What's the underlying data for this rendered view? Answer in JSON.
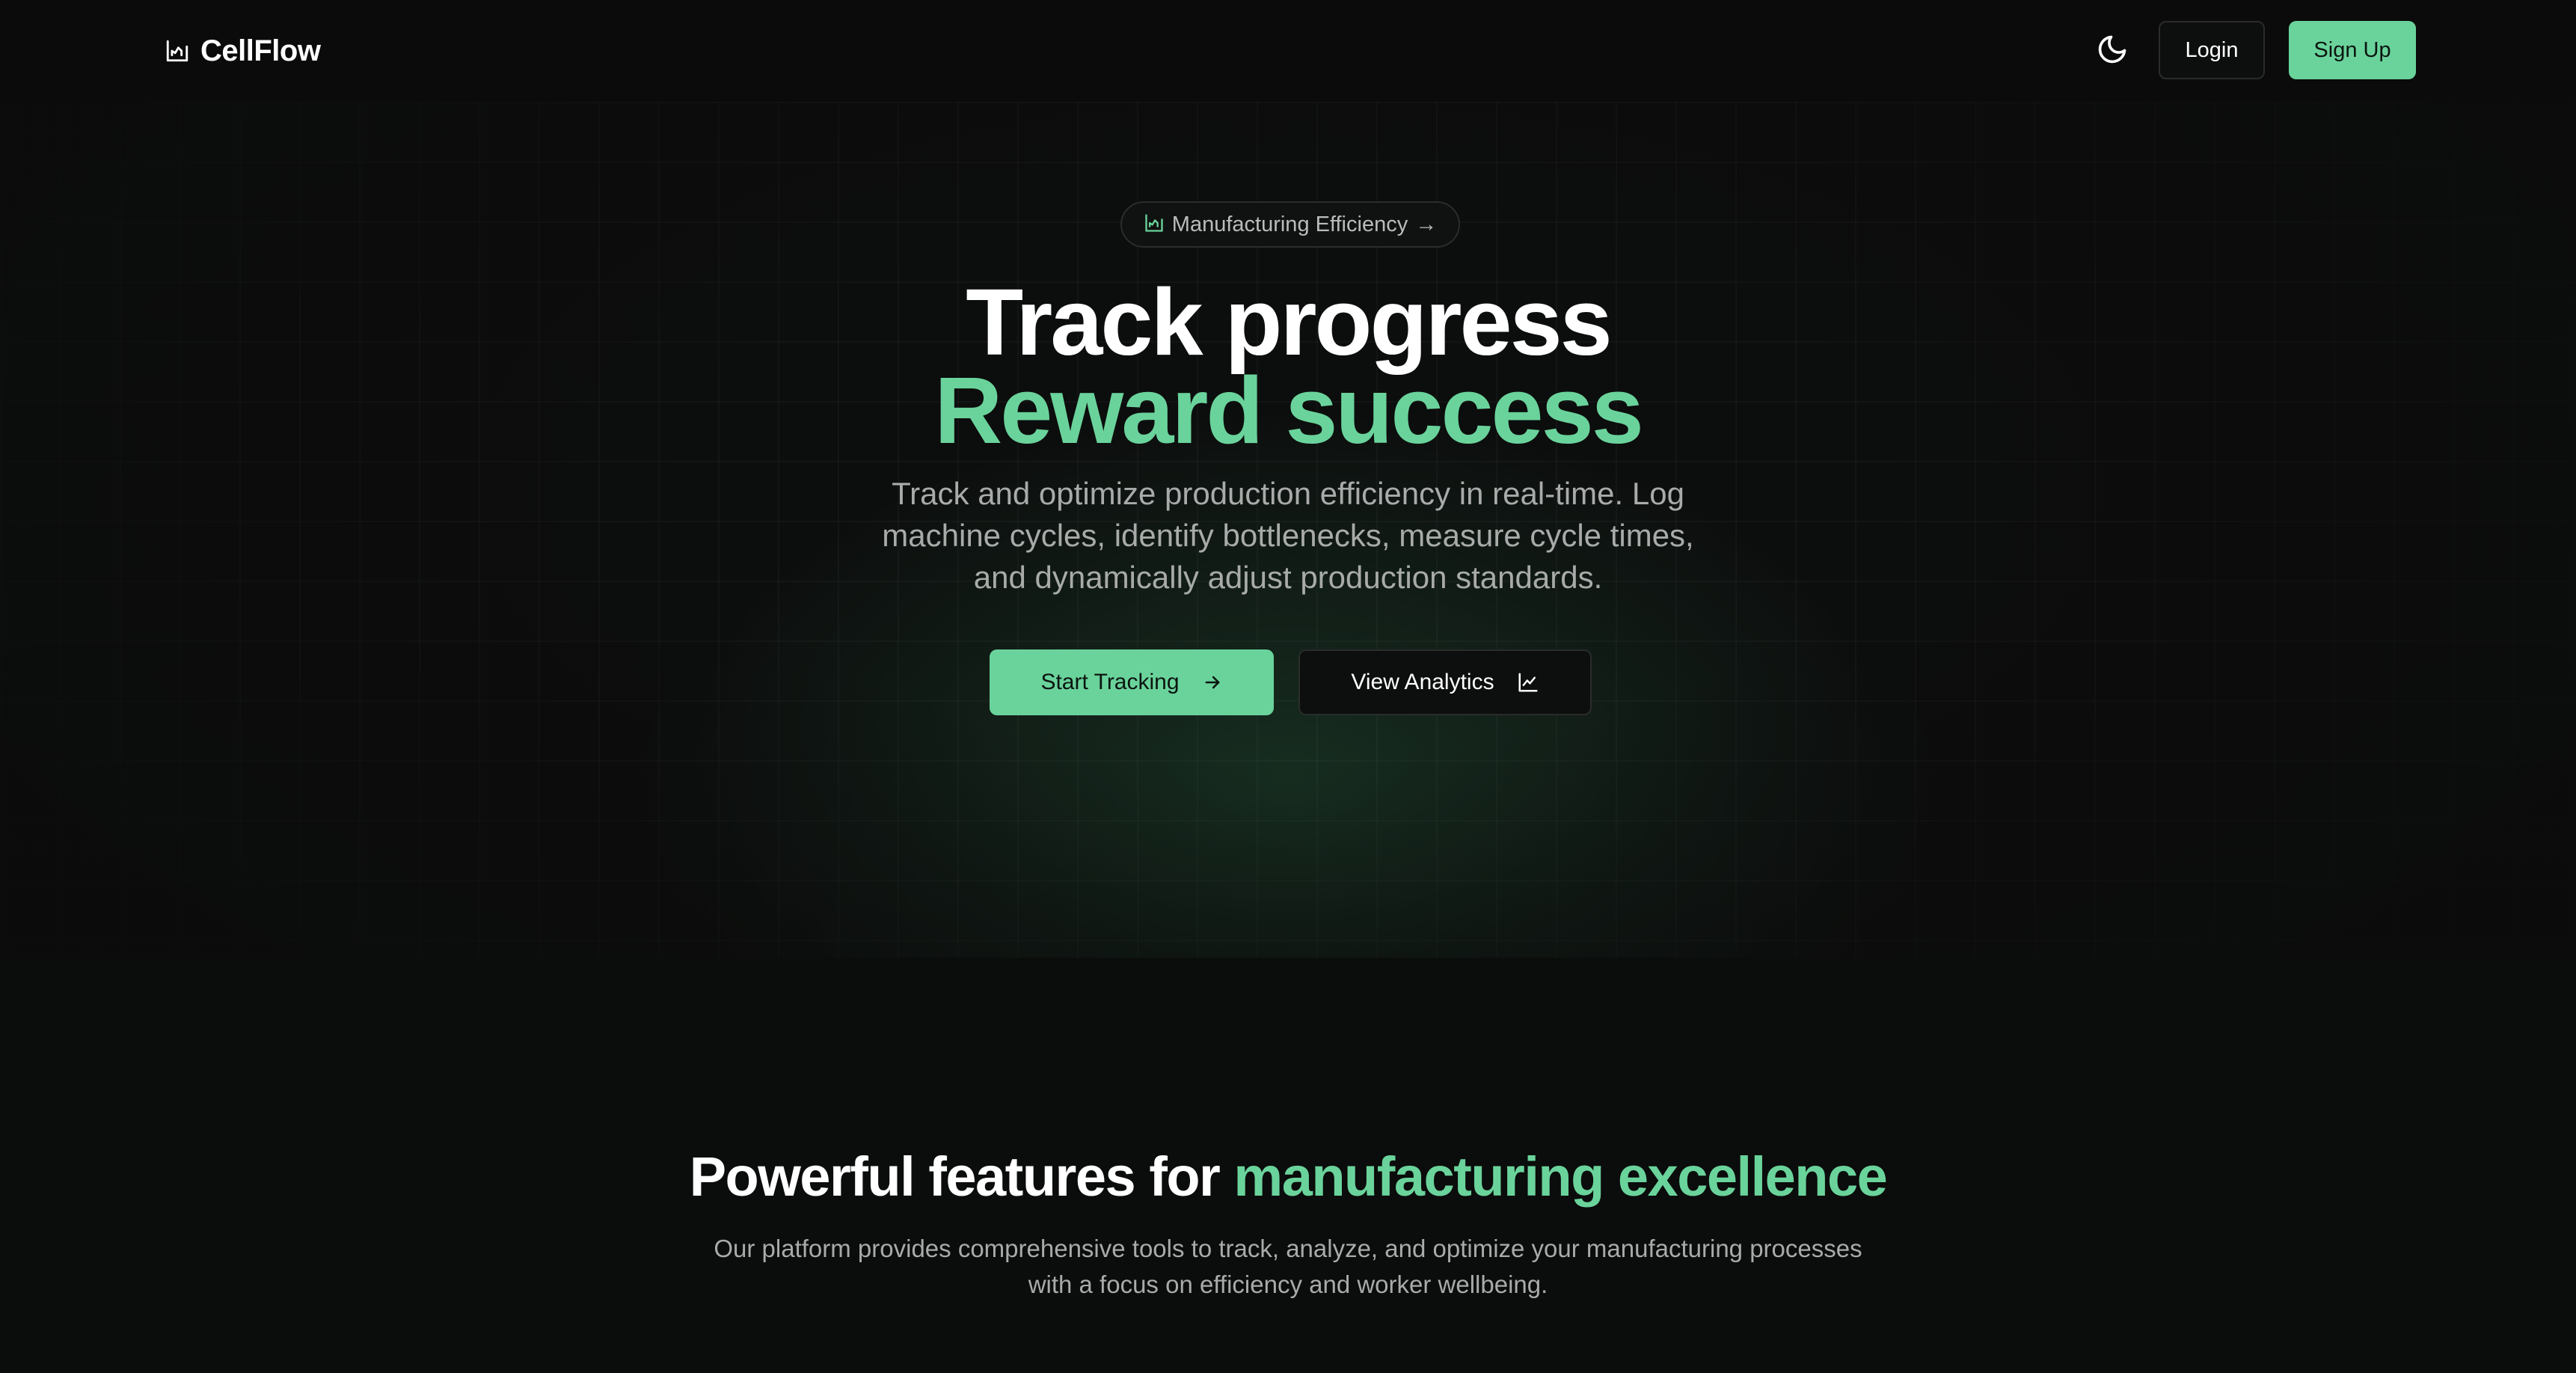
{
  "header": {
    "brand_icon": "chart-icon",
    "brand_name": "CellFlow",
    "theme_toggle_icon": "moon-icon",
    "login_label": "Login",
    "signup_label": "Sign Up"
  },
  "hero": {
    "badge": {
      "icon": "chart-icon",
      "label": "Manufacturing Efficiency",
      "arrow": "→"
    },
    "title_line1": "Track progress",
    "title_line2": "Reward success",
    "subtitle": "Track and optimize production efficiency in real-time. Log machine cycles, identify bottlenecks, measure cycle times, and dynamically adjust production standards.",
    "primary_button": {
      "label": "Start Tracking",
      "icon": "arrow-right-icon"
    },
    "secondary_button": {
      "label": "View Analytics",
      "icon": "line-chart-icon"
    }
  },
  "features": {
    "title_part1": "Powerful features for ",
    "title_part2": "manufacturing excellence",
    "subtitle": "Our platform provides comprehensive tools to track, analyze, and optimize your manufacturing processes with a focus on efficiency and worker wellbeing."
  },
  "colors": {
    "accent": "#6ad39b",
    "background": "#0b0c0c",
    "muted_text": "#a8aba9"
  }
}
